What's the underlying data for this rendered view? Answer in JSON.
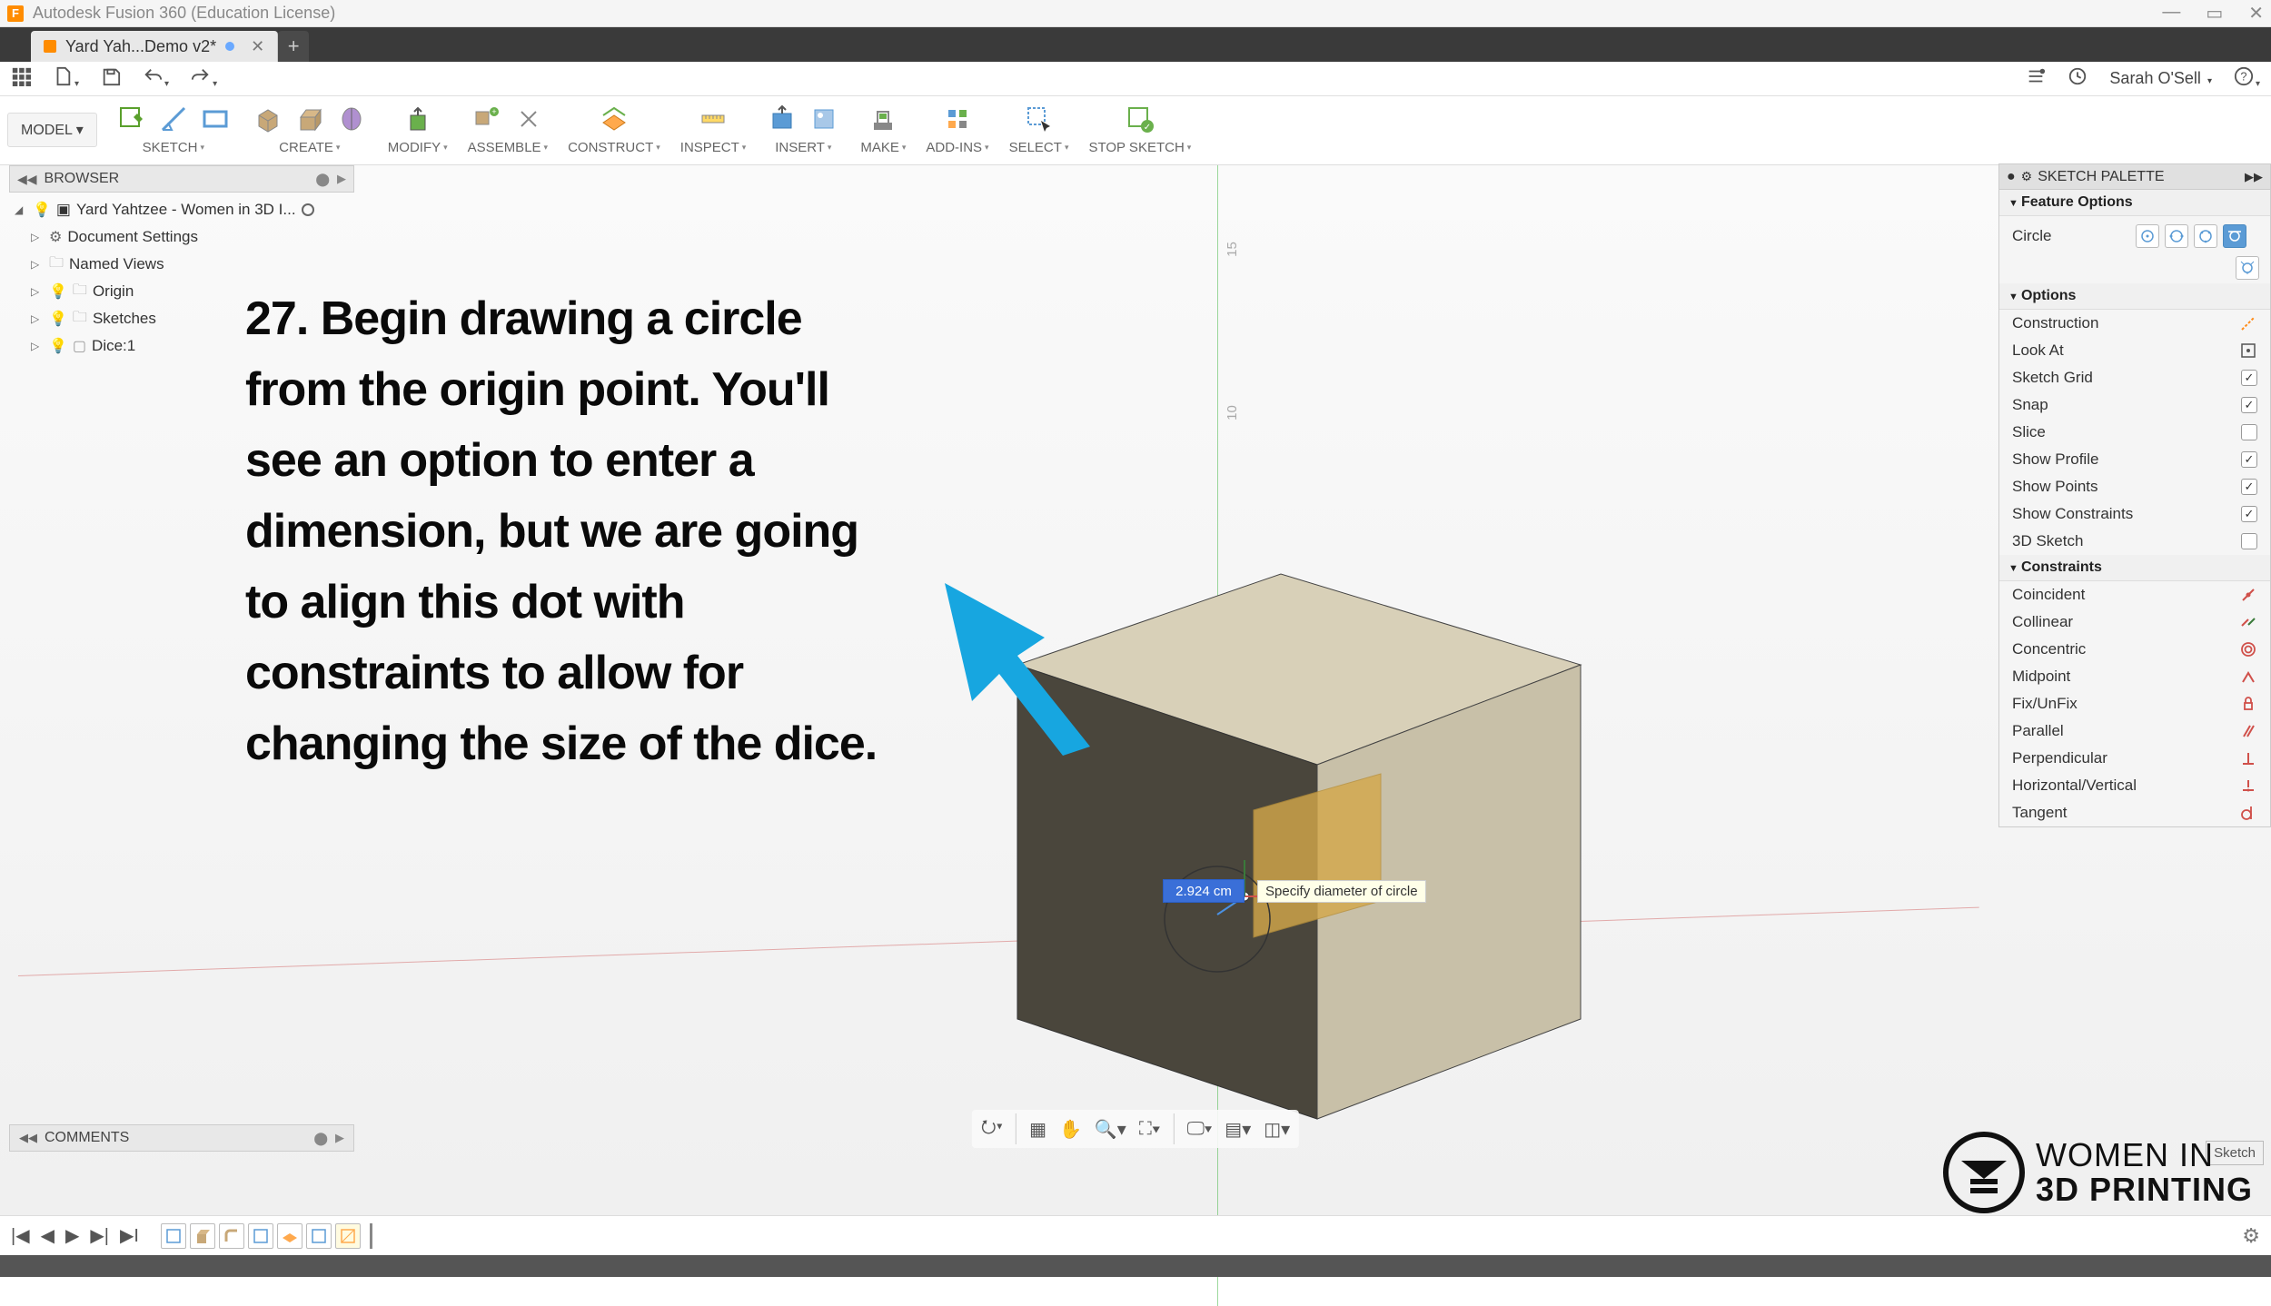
{
  "app": {
    "title": "Autodesk Fusion 360 (Education License)",
    "icon_letter": "F"
  },
  "tab": {
    "label": "Yard Yah...Demo v2*"
  },
  "user": {
    "name": "Sarah O'Sell"
  },
  "model_button": "MODEL",
  "toolbar": {
    "sketch": "SKETCH",
    "create": "CREATE",
    "modify": "MODIFY",
    "assemble": "ASSEMBLE",
    "construct": "CONSTRUCT",
    "inspect": "INSPECT",
    "insert": "INSERT",
    "make": "MAKE",
    "addins": "ADD-INS",
    "select": "SELECT",
    "stop_sketch": "STOP SKETCH"
  },
  "browser": {
    "title": "BROWSER",
    "root": "Yard Yahtzee - Women in 3D I...",
    "items": [
      {
        "label": "Document Settings",
        "icon": "gear"
      },
      {
        "label": "Named Views",
        "icon": "folder"
      },
      {
        "label": "Origin",
        "icon": "folder",
        "bulb": true
      },
      {
        "label": "Sketches",
        "icon": "folder",
        "bulb": true
      },
      {
        "label": "Dice:1",
        "icon": "body",
        "bulb": true
      }
    ]
  },
  "instruction": "27. Begin drawing a circle from the origin point. You'll see an option to enter a dimension, but we are going to align this dot with constraints to allow for changing the size of the dice.",
  "dimension": {
    "value": "2.924 cm",
    "hint": "Specify diameter of circle"
  },
  "palette": {
    "title": "SKETCH PALETTE",
    "sections": {
      "feature": "Feature Options",
      "options": "Options",
      "constraints": "Constraints"
    },
    "circle_label": "Circle",
    "options_rows": [
      {
        "label": "Construction",
        "type": "icon"
      },
      {
        "label": "Look At",
        "type": "icon"
      },
      {
        "label": "Sketch Grid",
        "type": "check",
        "on": true
      },
      {
        "label": "Snap",
        "type": "check",
        "on": true
      },
      {
        "label": "Slice",
        "type": "check",
        "on": false
      },
      {
        "label": "Show Profile",
        "type": "check",
        "on": true
      },
      {
        "label": "Show Points",
        "type": "check",
        "on": true
      },
      {
        "label": "Show Constraints",
        "type": "check",
        "on": true
      },
      {
        "label": "3D Sketch",
        "type": "check",
        "on": false
      }
    ],
    "constraints": [
      "Coincident",
      "Collinear",
      "Concentric",
      "Midpoint",
      "Fix/UnFix",
      "Parallel",
      "Perpendicular",
      "Horizontal/Vertical",
      "Tangent"
    ]
  },
  "comments": "COMMENTS",
  "watermark": {
    "line1": "WOMEN IN",
    "line2": "3D PRINTING"
  },
  "stop_btn_label": "Sketch",
  "ruler_marks": {
    "m15": "15",
    "m10": "10"
  }
}
